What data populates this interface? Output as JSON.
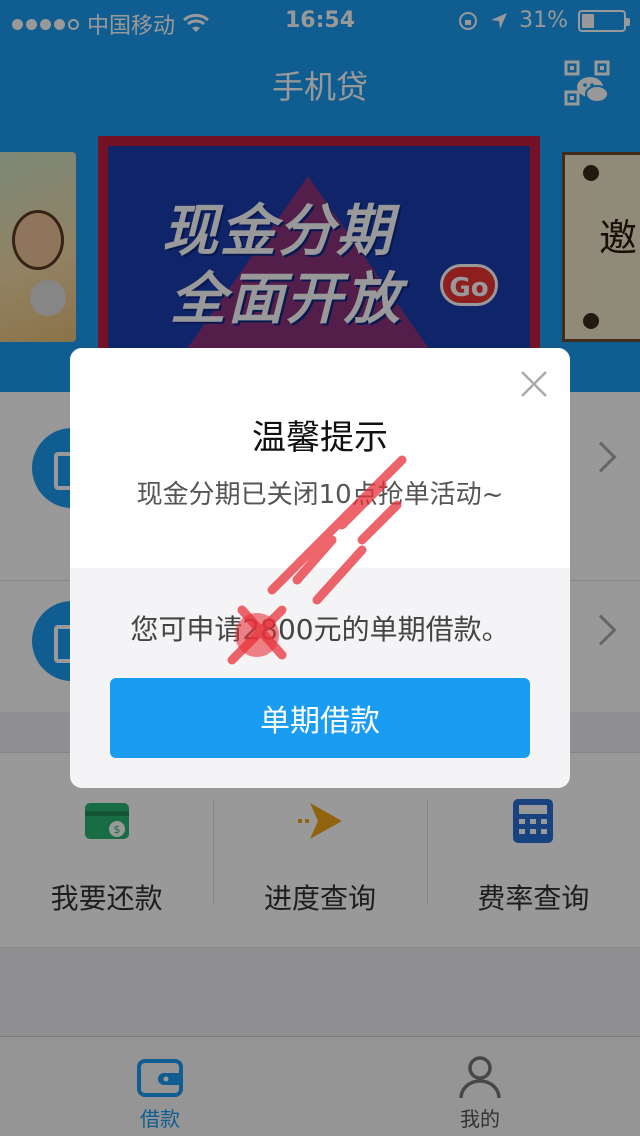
{
  "status_bar": {
    "carrier": "中国移动",
    "time": "16:54",
    "battery_percent": "31%",
    "battery_level": 0.31,
    "signal_bars": 4
  },
  "header": {
    "title": "手机贷",
    "right_icon": "qr-code-wechat-icon"
  },
  "banner": {
    "main_line1": "现金分期",
    "main_line2": "全面开放",
    "main_badge": "Go",
    "right_text": "邀"
  },
  "quick_actions": [
    {
      "label": "我要还款",
      "icon": "card-repay-icon",
      "color": "#2bb673"
    },
    {
      "label": "进度查询",
      "icon": "arrow-progress-icon",
      "color": "#f2a51a"
    },
    {
      "label": "费率查询",
      "icon": "calculator-icon",
      "color": "#2b6fd6"
    }
  ],
  "tabbar": [
    {
      "label": "借款",
      "icon": "wallet-icon",
      "active": true
    },
    {
      "label": "我的",
      "icon": "user-icon",
      "active": false
    }
  ],
  "dialog": {
    "title": "温馨提示",
    "message": "现金分期已关闭10点抢单活动~",
    "amount_text": "您可申请2800元的单期借款。",
    "button_label": "单期借款"
  },
  "colors": {
    "primary": "#1a9cf2",
    "overlay": "rgba(0,0,0,0.4)",
    "watermark": "#e8323a"
  }
}
